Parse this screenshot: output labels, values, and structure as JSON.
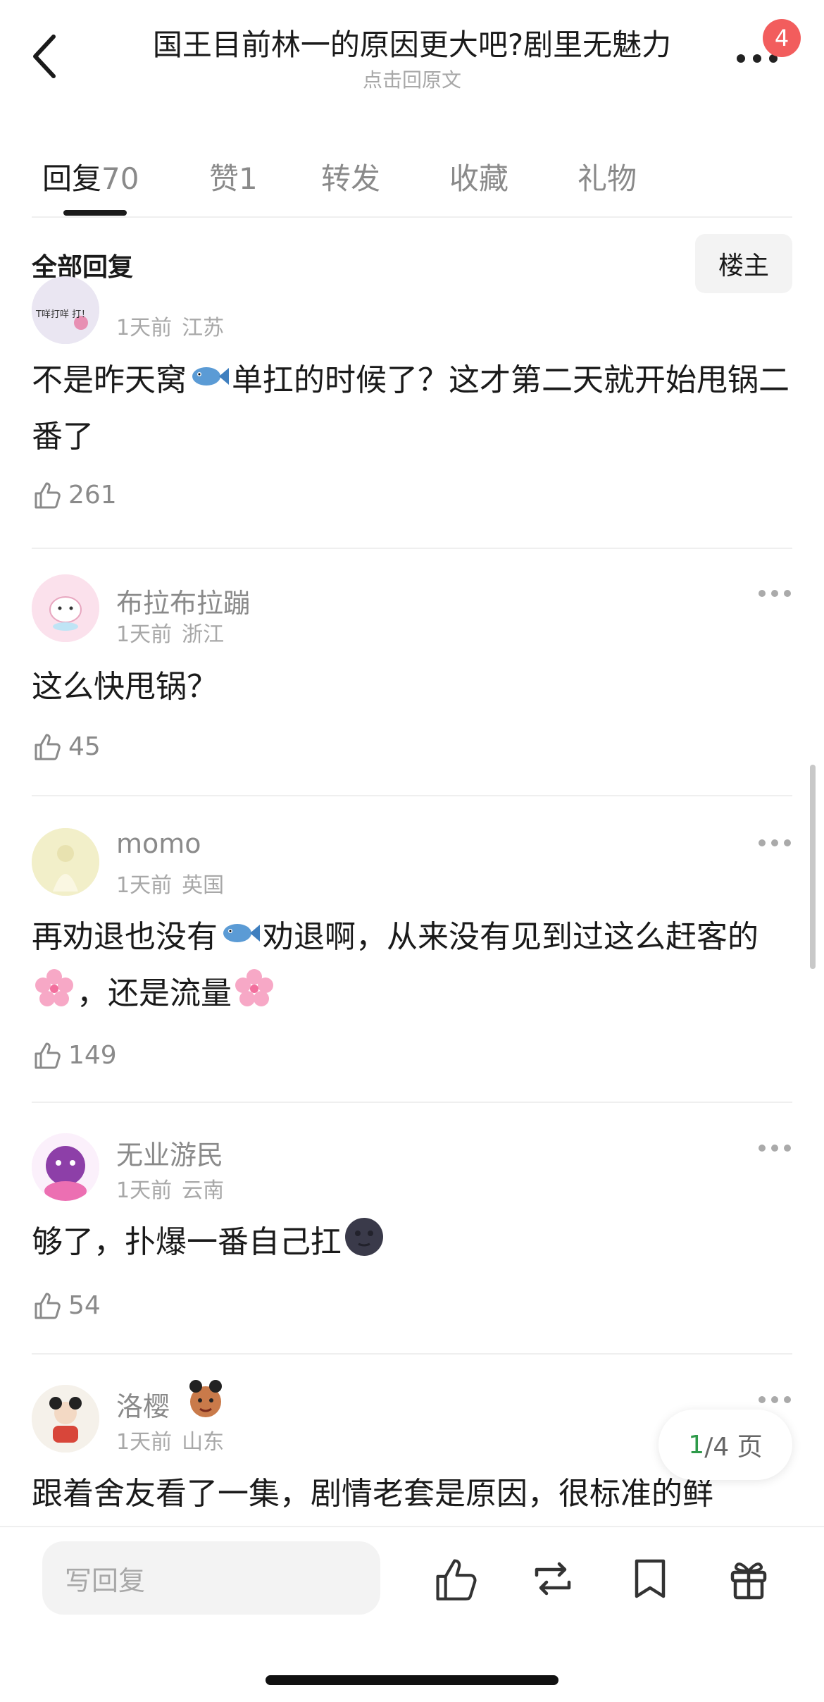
{
  "header": {
    "title": "国王目前林一的原因更大吧?剧里无魅力",
    "subtitle": "点击回原文",
    "notification_count": "4"
  },
  "tabs": [
    {
      "label": "回复",
      "count": "70"
    },
    {
      "label": "赞",
      "count": "1"
    },
    {
      "label": "转发",
      "count": ""
    },
    {
      "label": "收藏",
      "count": ""
    },
    {
      "label": "礼物",
      "count": ""
    }
  ],
  "filter": {
    "label": "全部回复",
    "owner_button": "楼主"
  },
  "comments": [
    {
      "username": "",
      "avatar_text": "T咩打咩 打！",
      "time": "1天前",
      "location": "江苏",
      "text_parts": [
        "不是昨天窝",
        "单扛的时候了？这才第二天就开始甩锅二番了"
      ],
      "likes": "261"
    },
    {
      "username": "布拉布拉蹦",
      "time": "1天前",
      "location": "浙江",
      "text_parts": [
        "这么快甩锅？"
      ],
      "likes": "45"
    },
    {
      "username": "momo",
      "time": "1天前",
      "location": "英国",
      "text_parts": [
        "再劝退也没有",
        "劝退啊，从来没有见到过这么赶客的",
        "，还是流量"
      ],
      "likes": "149"
    },
    {
      "username": "无业游民",
      "time": "1天前",
      "location": "云南",
      "text_parts": [
        "够了，扑爆一番自己扛"
      ],
      "likes": "54"
    },
    {
      "username": "洛樱",
      "time": "1天前",
      "location": "山东",
      "text_parts": [
        "跟着舍友看了一集，剧情老套是原因，很标准的鲜"
      ],
      "likes": ""
    }
  ],
  "pagination": {
    "current": "1",
    "total_text": "/4 页"
  },
  "bottom_bar": {
    "reply_placeholder": "写回复"
  },
  "colors": {
    "accent_green": "#2e9a4a",
    "badge_red": "#f25d5d",
    "muted_text": "#8a8a8a"
  },
  "icons": [
    "back-arrow-icon",
    "more-icon",
    "thumb-up-icon",
    "fish-emoji-icon",
    "cherry-blossom-emoji-icon",
    "new-moon-face-emoji-icon",
    "repost-icon",
    "bookmark-icon",
    "gift-icon"
  ]
}
